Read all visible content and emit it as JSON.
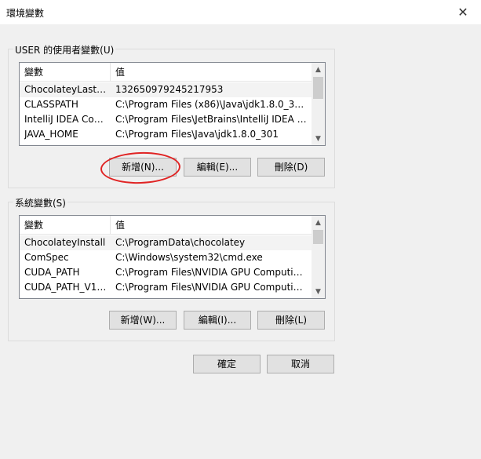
{
  "window": {
    "title": "環境變數",
    "close_glyph": "✕"
  },
  "user_vars": {
    "group_label": "USER 的使用者變數(U)",
    "col_variable": "變數",
    "col_value": "值",
    "rows": [
      {
        "name": "ChocolateyLastP...",
        "value": "132650979245217953"
      },
      {
        "name": "CLASSPATH",
        "value": "C:\\Program Files (x86)\\Java\\jdk1.8.0_301\\..."
      },
      {
        "name": "IntelliJ IDEA Com...",
        "value": "C:\\Program Files\\JetBrains\\IntelliJ IDEA C..."
      },
      {
        "name": "JAVA_HOME",
        "value": "C:\\Program Files\\Java\\jdk1.8.0_301"
      }
    ],
    "new_label": "新增(N)...",
    "edit_label": "編輯(E)...",
    "delete_label": "刪除(D)"
  },
  "system_vars": {
    "group_label": "系統變數(S)",
    "col_variable": "變數",
    "col_value": "值",
    "rows": [
      {
        "name": "ChocolateyInstall",
        "value": "C:\\ProgramData\\chocolatey"
      },
      {
        "name": "ComSpec",
        "value": "C:\\Windows\\system32\\cmd.exe"
      },
      {
        "name": "CUDA_PATH",
        "value": "C:\\Program Files\\NVIDIA GPU Computing..."
      },
      {
        "name": "CUDA_PATH_V11...",
        "value": "C:\\Program Files\\NVIDIA GPU Computing..."
      }
    ],
    "new_label": "新增(W)...",
    "edit_label": "編輯(I)...",
    "delete_label": "刪除(L)"
  },
  "footer": {
    "ok_label": "確定",
    "cancel_label": "取消"
  },
  "annotation_color": "#e02424"
}
